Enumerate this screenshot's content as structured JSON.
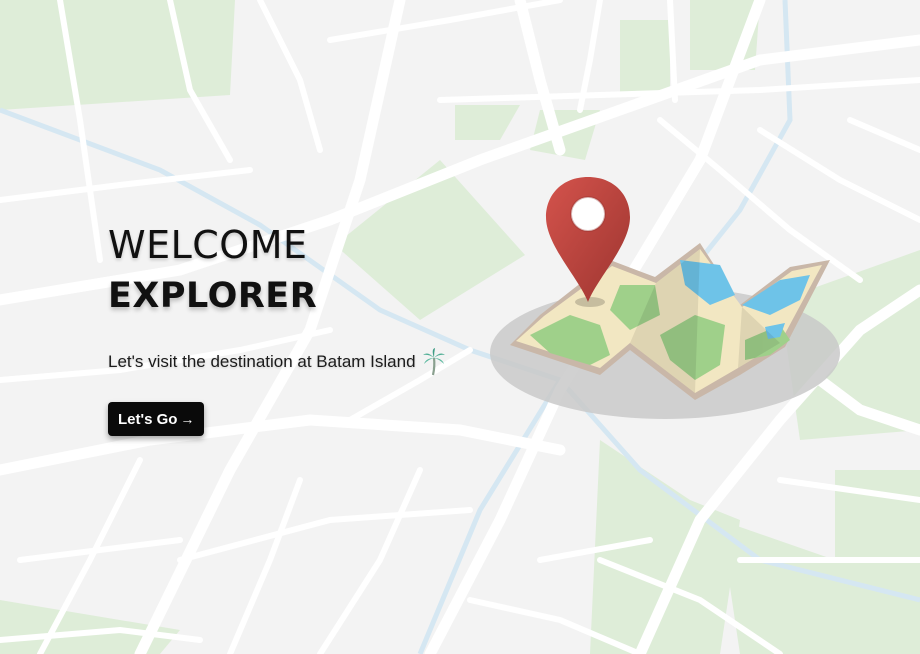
{
  "hero": {
    "heading_line1": "WELCOME",
    "heading_line2": "EXPLORER",
    "tagline": "Let's visit the destination at Batam Island",
    "cta_label": "Let's Go",
    "cta_arrow": "→"
  },
  "icons": {
    "tagline_icon": "palm-tree-icon",
    "illustration": "map-location-pin-icon"
  },
  "colors": {
    "background": "#f3f3f3",
    "park_green": "#dfeeda",
    "road": "#ffffff",
    "water": "#d6e8f3",
    "button_bg": "#0a0a0a",
    "button_text": "#ffffff",
    "pin_red": "#c0453f"
  }
}
